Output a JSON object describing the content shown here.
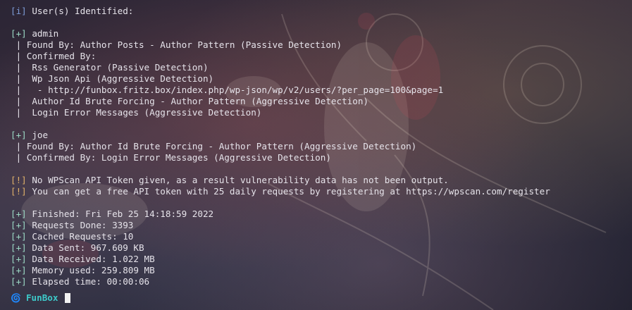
{
  "prompt": {
    "icon": "spiral-icon",
    "name": "FunBox"
  },
  "lines": [
    {
      "tag": "[i]",
      "text": " User(s) Identified:"
    },
    {
      "tag": "",
      "text": ""
    },
    {
      "tag": "[+]",
      "text": " admin"
    },
    {
      "tag": "",
      "text": " | Found By: Author Posts - Author Pattern (Passive Detection)"
    },
    {
      "tag": "",
      "text": " | Confirmed By:"
    },
    {
      "tag": "",
      "text": " |  Rss Generator (Passive Detection)"
    },
    {
      "tag": "",
      "text": " |  Wp Json Api (Aggressive Detection)"
    },
    {
      "tag": "",
      "text": " |   - http://funbox.fritz.box/index.php/wp-json/wp/v2/users/?per_page=100&page=1"
    },
    {
      "tag": "",
      "text": " |  Author Id Brute Forcing - Author Pattern (Aggressive Detection)"
    },
    {
      "tag": "",
      "text": " |  Login Error Messages (Aggressive Detection)"
    },
    {
      "tag": "",
      "text": ""
    },
    {
      "tag": "[+]",
      "text": " joe"
    },
    {
      "tag": "",
      "text": " | Found By: Author Id Brute Forcing - Author Pattern (Aggressive Detection)"
    },
    {
      "tag": "",
      "text": " | Confirmed By: Login Error Messages (Aggressive Detection)"
    },
    {
      "tag": "",
      "text": ""
    },
    {
      "tag": "[!]",
      "text": " No WPScan API Token given, as a result vulnerability data has not been output."
    },
    {
      "tag": "[!]",
      "text": " You can get a free API token with 25 daily requests by registering at https://wpscan.com/register"
    },
    {
      "tag": "",
      "text": ""
    },
    {
      "tag": "[+]",
      "text": " Finished: Fri Feb 25 14:18:59 2022"
    },
    {
      "tag": "[+]",
      "text": " Requests Done: 3393"
    },
    {
      "tag": "[+]",
      "text": " Cached Requests: 10"
    },
    {
      "tag": "[+]",
      "text": " Data Sent: 967.609 KB"
    },
    {
      "tag": "[+]",
      "text": " Data Received: 1.022 MB"
    },
    {
      "tag": "[+]",
      "text": " Memory used: 259.809 MB"
    },
    {
      "tag": "[+]",
      "text": " Elapsed time: 00:00:06"
    }
  ],
  "colors": {
    "info": "#7d9bd6",
    "plus": "#9bd8c4",
    "warn": "#e0b16a",
    "prompt": "#3dc9c9",
    "text": "#e6e3ea"
  }
}
